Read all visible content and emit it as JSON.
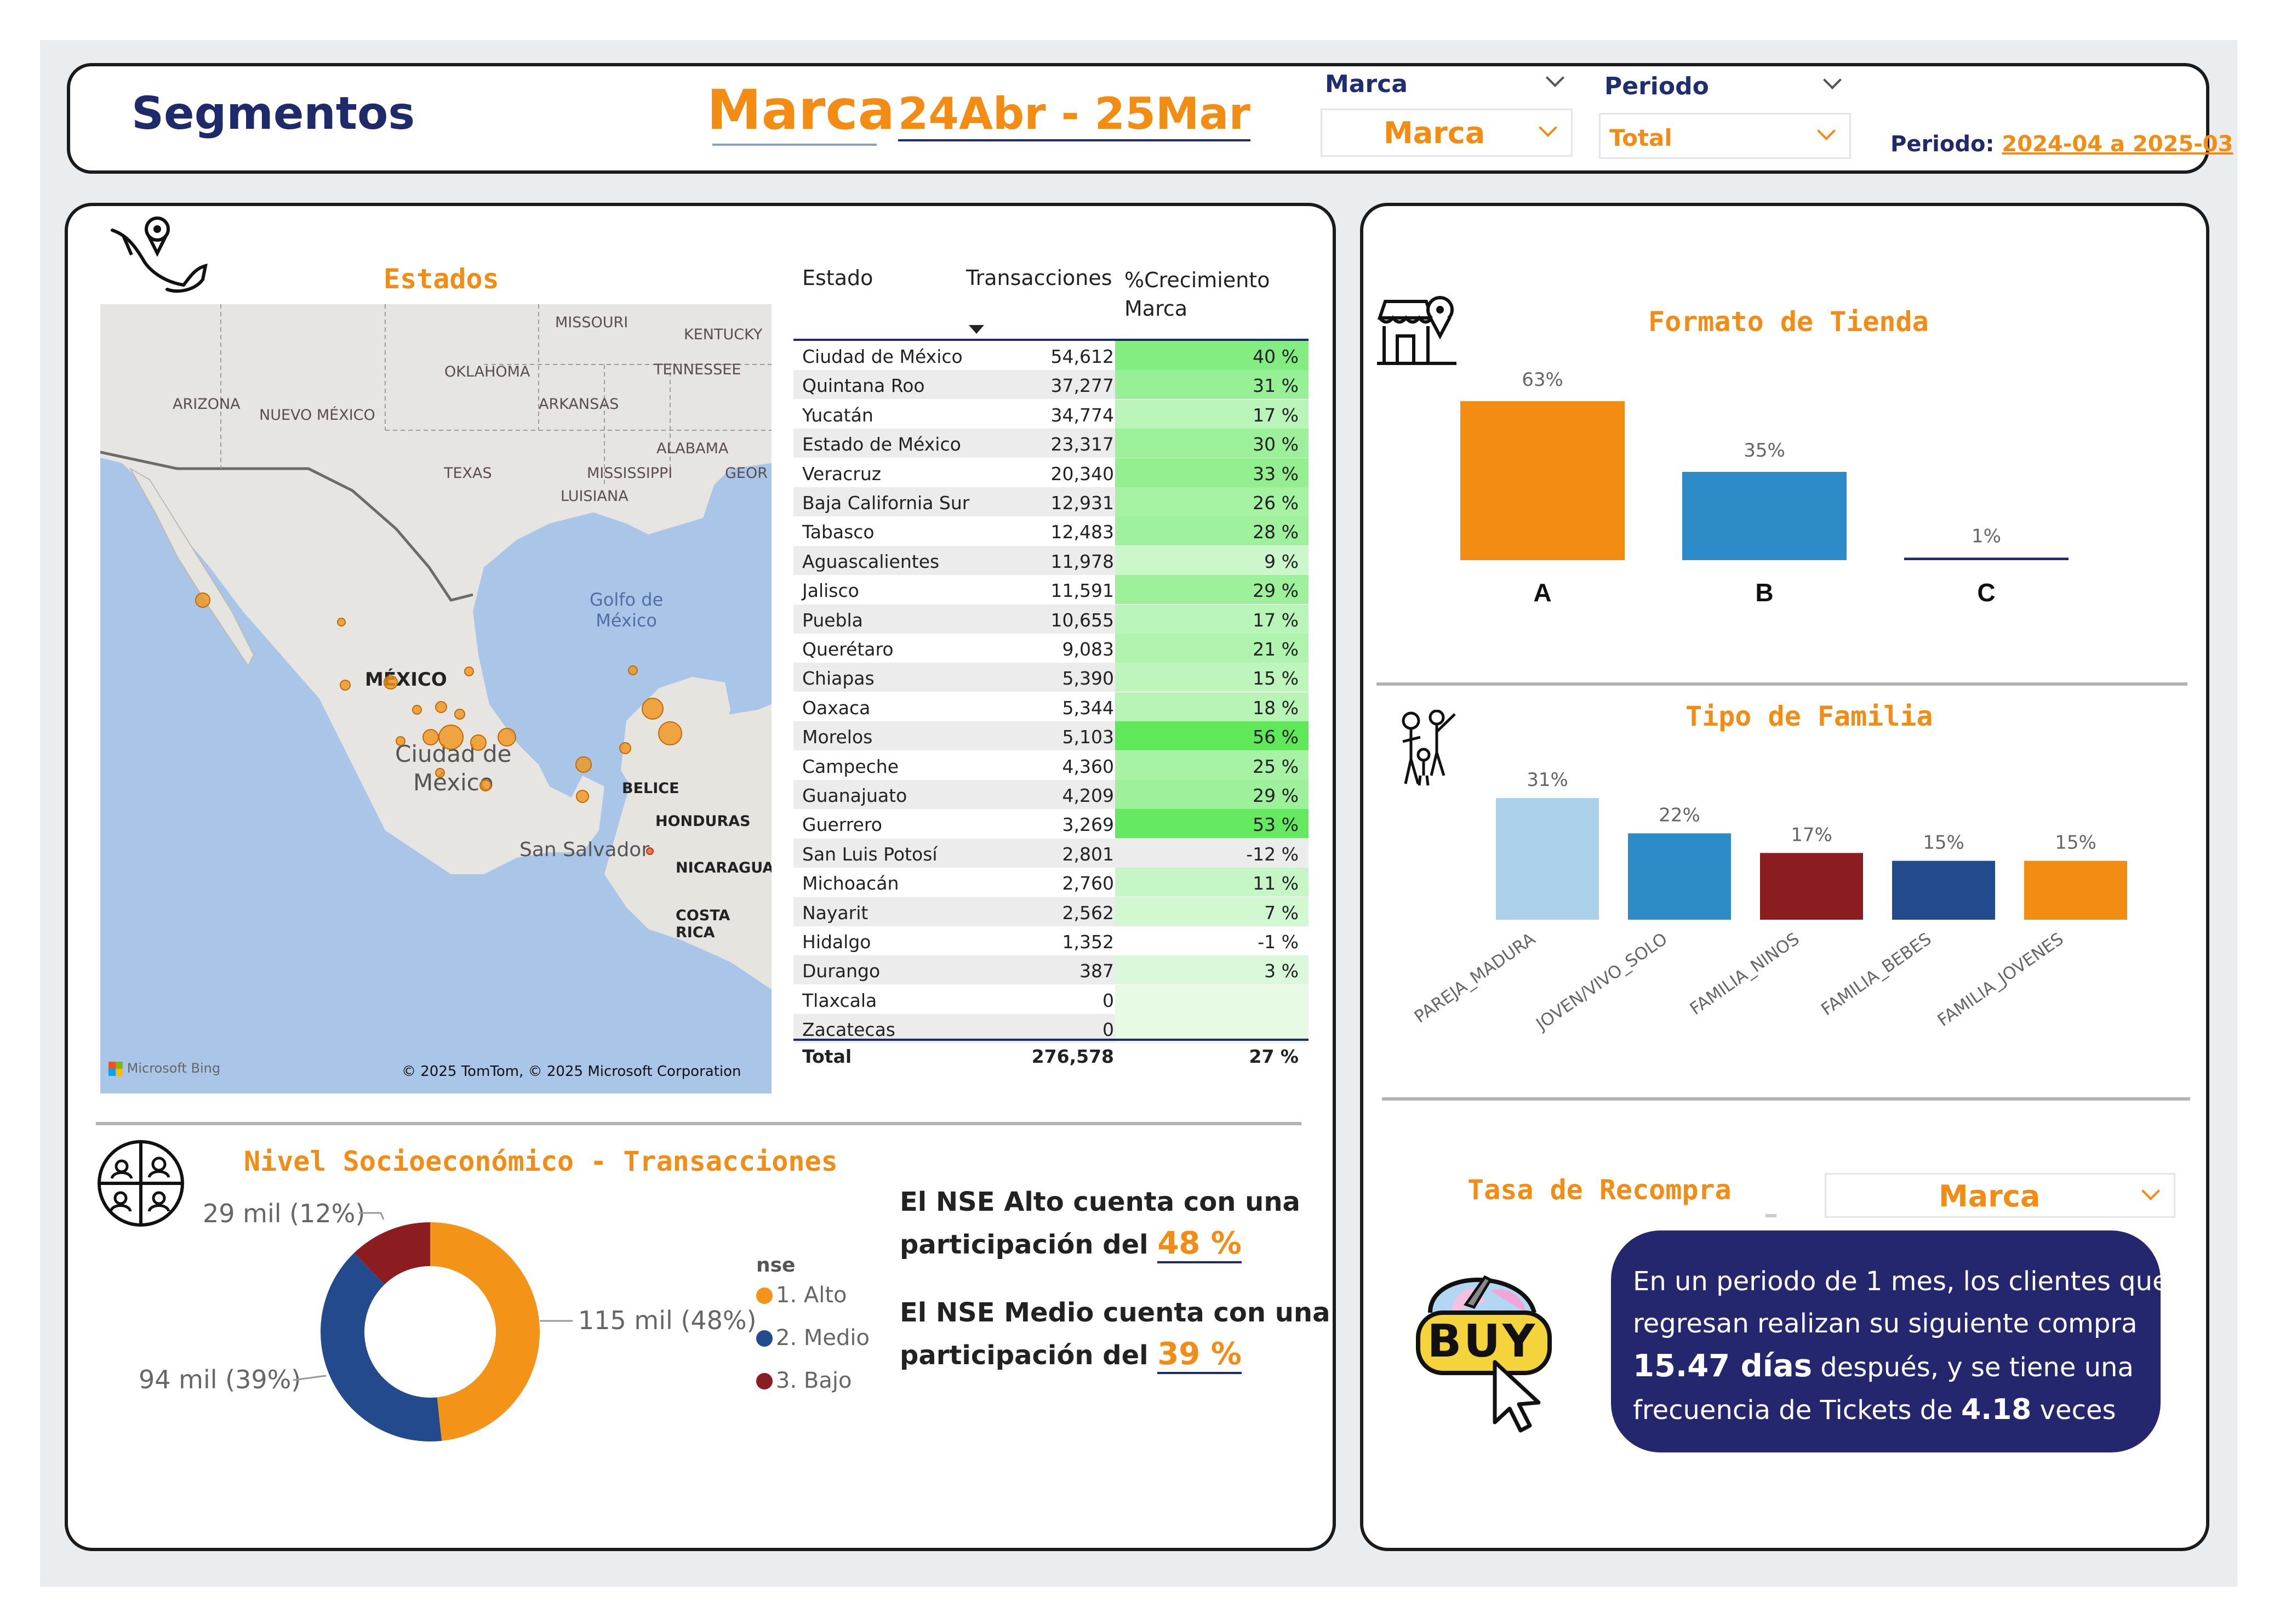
{
  "header": {
    "title": "Segmentos",
    "brand_big": "Marca",
    "period_big": "24Abr - 25Mar",
    "slicer_marca_label": "Marca",
    "slicer_marca_value": "Marca",
    "slicer_periodo_label": "Periodo",
    "slicer_periodo_value": "Total",
    "periodo_caption": "Periodo:",
    "periodo_value": "2024-04 a 2025-03"
  },
  "colors": {
    "orange": "#f28c13",
    "navy": "#23266e",
    "blue": "#2d8bc7",
    "light_blue": "#abd1ea",
    "dark_red": "#8b1c1f",
    "dark_blue": "#224a8c",
    "green_max": "#5ee85a"
  },
  "map": {
    "title": "Estados",
    "labels": {
      "missouri": "MISSOURI",
      "kentucky": "KENTUCKY",
      "oklahoma": "OKLAHOMA",
      "tennessee": "TENNESSEE",
      "arizona": "ARIZONA",
      "nuevo_mexico": "NUEVO MÉXICO",
      "arkansas": "ARKANSAS",
      "alabama": "ALABAMA",
      "texas": "TEXAS",
      "mississippi": "MISSISSIPPI",
      "georgia": "GEOR",
      "luisiana": "LUISIANA",
      "golfo": "Golfo de\nMéxico",
      "mexico": "MÉXICO",
      "cdmx": "Ciudad de\nMéxico",
      "belice": "BELICE",
      "honduras": "HONDURAS",
      "san_salvador": "San Salvador",
      "nicaragua": "NICARAGUA",
      "costa_rica": "COSTA RICA"
    },
    "bing_logo": "Microsoft Bing",
    "copyright": "© 2025 TomTom, © 2025 Microsoft Corporation"
  },
  "table": {
    "headers": [
      "Estado",
      "Transacciones",
      "%Crecimiento\nMarca"
    ],
    "rows": [
      {
        "estado": "Ciudad de México",
        "trans": "54,612",
        "pct": "40 %",
        "g": 40
      },
      {
        "estado": "Quintana Roo",
        "trans": "37,277",
        "pct": "31 %",
        "g": 31
      },
      {
        "estado": "Yucatán",
        "trans": "34,774",
        "pct": "17 %",
        "g": 17
      },
      {
        "estado": "Estado de México",
        "trans": "23,317",
        "pct": "30 %",
        "g": 30
      },
      {
        "estado": "Veracruz",
        "trans": "20,340",
        "pct": "33 %",
        "g": 33
      },
      {
        "estado": "Baja California Sur",
        "trans": "12,931",
        "pct": "26 %",
        "g": 26
      },
      {
        "estado": "Tabasco",
        "trans": "12,483",
        "pct": "28 %",
        "g": 28
      },
      {
        "estado": "Aguascalientes",
        "trans": "11,978",
        "pct": "9 %",
        "g": 9
      },
      {
        "estado": "Jalisco",
        "trans": "11,591",
        "pct": "29 %",
        "g": 29
      },
      {
        "estado": "Puebla",
        "trans": "10,655",
        "pct": "17 %",
        "g": 17
      },
      {
        "estado": "Querétaro",
        "trans": "9,083",
        "pct": "21 %",
        "g": 21
      },
      {
        "estado": "Chiapas",
        "trans": "5,390",
        "pct": "15 %",
        "g": 15
      },
      {
        "estado": "Oaxaca",
        "trans": "5,344",
        "pct": "18 %",
        "g": 18
      },
      {
        "estado": "Morelos",
        "trans": "5,103",
        "pct": "56 %",
        "g": 56
      },
      {
        "estado": "Campeche",
        "trans": "4,360",
        "pct": "25 %",
        "g": 25
      },
      {
        "estado": "Guanajuato",
        "trans": "4,209",
        "pct": "29 %",
        "g": 29
      },
      {
        "estado": "Guerrero",
        "trans": "3,269",
        "pct": "53 %",
        "g": 53
      },
      {
        "estado": "San Luis Potosí",
        "trans": "2,801",
        "pct": "-12 %",
        "g": -12
      },
      {
        "estado": "Michoacán",
        "trans": "2,760",
        "pct": "11 %",
        "g": 11
      },
      {
        "estado": "Nayarit",
        "trans": "2,562",
        "pct": "7 %",
        "g": 7
      },
      {
        "estado": "Hidalgo",
        "trans": "1,352",
        "pct": "-1 %",
        "g": -1
      },
      {
        "estado": "Durango",
        "trans": "387",
        "pct": "3 %",
        "g": 3
      },
      {
        "estado": "Tlaxcala",
        "trans": "0",
        "pct": "",
        "g": 0
      },
      {
        "estado": "Zacatecas",
        "trans": "0",
        "pct": "",
        "g": 0
      }
    ],
    "total": {
      "label": "Total",
      "trans": "276,578",
      "pct": "27 %"
    }
  },
  "nse": {
    "title": "Nivel Socioeconómico - Transacciones",
    "legend_title": "nse",
    "slice_labels": [
      "115 mil (48%)",
      "94 mil (39%)",
      "29 mil (12%)"
    ],
    "text1_a": "El NSE Alto cuenta con una",
    "text1_b": "participación del",
    "text1_val": "48 %",
    "text2_a": "El NSE Medio cuenta con una",
    "text2_b": "participación del",
    "text2_val": "39 %"
  },
  "formato": {
    "title": "Formato de Tienda"
  },
  "familia": {
    "title": "Tipo de Familia"
  },
  "recompra": {
    "title": "Tasa de Recompra",
    "slicer_value": "Marca",
    "buy_text": "BUY",
    "msg_1": "En un periodo de 1 mes, los clientes que",
    "msg_2": "regresan realizan su siguiente compra",
    "msg_days": "15.47 días",
    "msg_3": " después, y se tiene una",
    "msg_4": "frecuencia de Tickets de ",
    "msg_times": "4.18",
    "msg_5": " veces"
  },
  "chart_data": [
    {
      "type": "pie",
      "title": "Nivel Socioeconómico - Transacciones",
      "legend_title": "nse",
      "categories": [
        "1. Alto",
        "2. Medio",
        "3. Bajo"
      ],
      "values": [
        115,
        94,
        29
      ],
      "percents": [
        48,
        39,
        12
      ],
      "colors": [
        "#f39419",
        "#224a8c",
        "#8b1c1f"
      ],
      "donut": true
    },
    {
      "type": "bar",
      "title": "Formato de Tienda",
      "categories": [
        "A",
        "B",
        "C"
      ],
      "values": [
        63,
        35,
        1
      ],
      "labels": [
        "63%",
        "35%",
        "1%"
      ],
      "colors": [
        "#f28c13",
        "#2d8bc7",
        "#23266e"
      ],
      "ylim": [
        0,
        63
      ]
    },
    {
      "type": "bar",
      "title": "Tipo de Familia",
      "categories": [
        "PAREJA_MADURA",
        "JOVEN/VIVO_SOLO",
        "FAMILIA_NINOS",
        "FAMILIA_BEBES",
        "FAMILIA_JOVENES"
      ],
      "values": [
        31,
        22,
        17,
        15,
        15
      ],
      "labels": [
        "31%",
        "22%",
        "17%",
        "15%",
        "15%"
      ],
      "colors": [
        "#abd1ea",
        "#2d8bc7",
        "#8b1c1f",
        "#224a8c",
        "#f28c13"
      ],
      "ylim": [
        0,
        31
      ]
    }
  ]
}
